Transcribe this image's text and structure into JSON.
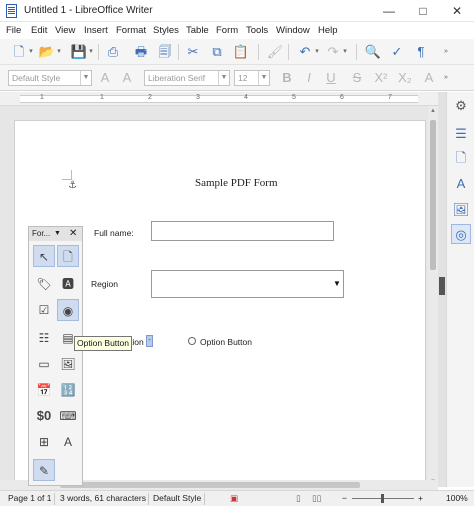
{
  "window": {
    "title": "Untitled 1 - LibreOffice Writer",
    "minimize": "—",
    "maximize": "□",
    "close": "✕"
  },
  "menu": [
    "File",
    "Edit",
    "View",
    "Insert",
    "Format",
    "Styles",
    "Table",
    "Form",
    "Tools",
    "Window",
    "Help"
  ],
  "toolbar": {
    "paragraph_style": "Default Style",
    "font_name": "Liberation Serif",
    "font_size": "12"
  },
  "ruler": {
    "numbers": [
      "1",
      "1",
      "2",
      "3",
      "4",
      "5",
      "6",
      "7"
    ]
  },
  "document": {
    "title": "Sample PDF Form",
    "full_name_label": "Full name:",
    "region_label": "Region",
    "option_fragment": "tion",
    "option_label": "Option Button"
  },
  "form_toolbar": {
    "title": "For...",
    "currency_label": "$0"
  },
  "tooltip": "Option Button",
  "status": {
    "page": "Page 1 of 1",
    "words": "3 words, 61 characters",
    "style": "Default Style",
    "zoom": "100%"
  }
}
